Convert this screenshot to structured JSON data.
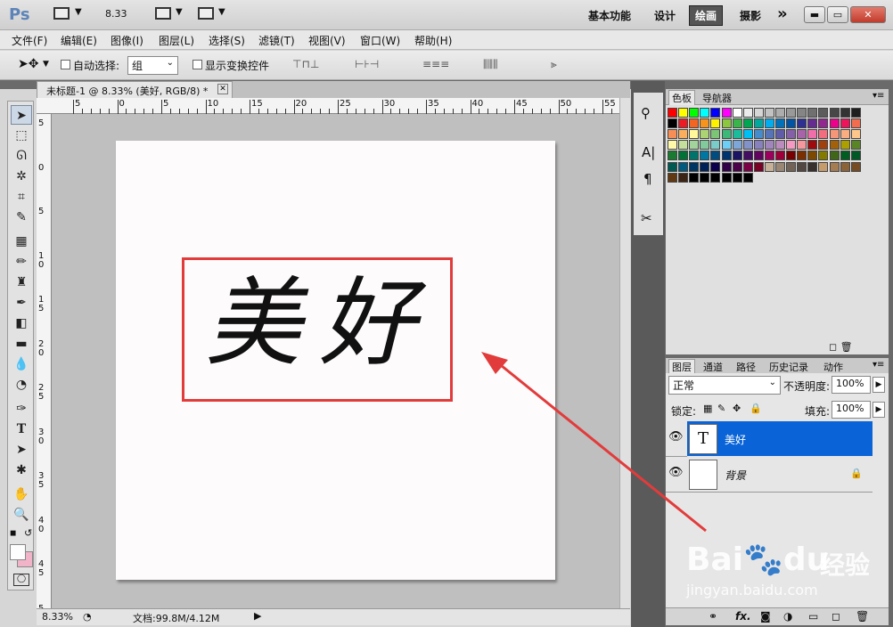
{
  "titlebar": {
    "logo": "Ps",
    "zoom": "8.33",
    "workspaces": [
      "基本功能",
      "设计",
      "绘画",
      "摄影"
    ],
    "active_workspace": "绘画",
    "more": "»"
  },
  "menu": [
    "文件(F)",
    "编辑(E)",
    "图像(I)",
    "图层(L)",
    "选择(S)",
    "滤镜(T)",
    "视图(V)",
    "窗口(W)",
    "帮助(H)"
  ],
  "options": {
    "auto_select_label": "自动选择:",
    "auto_select_value": "组",
    "show_transform_label": "显示变换控件"
  },
  "document": {
    "tab_title": "未标题-1 @ 8.33% (美好, RGB/8) *",
    "canvas_text": "美好",
    "ruler_h": [
      "5",
      "0",
      "5",
      "10",
      "15",
      "20",
      "25",
      "30",
      "35",
      "40",
      "45",
      "50",
      "55"
    ],
    "ruler_v": [
      "5",
      "0",
      "5",
      "1 0",
      "1 5",
      "2 0",
      "2 5",
      "3 0",
      "3 5",
      "4 0",
      "4 5",
      "5 0"
    ],
    "status_zoom": "8.33%",
    "status_doc": "文档:99.8M/4.12M"
  },
  "swatches_panel": {
    "tabs": [
      "色板",
      "导航器"
    ],
    "active_tab": "色板"
  },
  "swatch_colors": [
    [
      "#ff0000",
      "#ffff00",
      "#00ff00",
      "#00ffff",
      "#0000ff",
      "#ff00ff",
      "#ffffff",
      "#ebebeb",
      "#d6d6d6",
      "#c2c2c2",
      "#adadad",
      "#999999",
      "#858585",
      "#707070",
      "#5c5c5c",
      "#474747",
      "#333333",
      "#1f1f1f"
    ],
    [
      "#000000",
      "#ed1c24",
      "#f26522",
      "#f7941d",
      "#fff200",
      "#8dc63f",
      "#39b54a",
      "#00a651",
      "#00a99d",
      "#00aeef",
      "#0072bc",
      "#0054a6",
      "#2e3192",
      "#662d91",
      "#92278f",
      "#ec008c",
      "#ed145b",
      "#f26c4f"
    ],
    [
      "#f68e56",
      "#fbaf5d",
      "#fff799",
      "#acd373",
      "#7cc576",
      "#3cb878",
      "#1abc9c",
      "#00bff3",
      "#448ccb",
      "#5674b9",
      "#605ca8",
      "#855fa8",
      "#a864a8",
      "#f06eaa",
      "#f26d7d",
      "#f69679",
      "#f9ad81",
      "#fdc68a"
    ],
    [
      "#fff9a8",
      "#c4df9b",
      "#a3d39c",
      "#82ca9c",
      "#7accc8",
      "#6dcff6",
      "#7da7d9",
      "#8393ca",
      "#8781bd",
      "#a186be",
      "#bd8cbf",
      "#f49ac2",
      "#f5989d",
      "#9e0b0f",
      "#a0410d",
      "#a36209",
      "#aba000",
      "#598527"
    ],
    [
      "#197b30",
      "#007236",
      "#00746b",
      "#0076a3",
      "#004b80",
      "#003471",
      "#1b1464",
      "#440e62",
      "#630460",
      "#9e005d",
      "#9e0039",
      "#790000",
      "#7b2e00",
      "#7d4900",
      "#827b00",
      "#406618",
      "#005e20",
      "#005826"
    ],
    [
      "#005952",
      "#005b7f",
      "#003663",
      "#002157",
      "#0d004c",
      "#32004b",
      "#4b0049",
      "#7b0046",
      "#7a0026",
      "#c7b299",
      "#998675",
      "#736357",
      "#534741",
      "#37302d",
      "#c69c6d",
      "#a67c52",
      "#8c6239",
      "#754c24"
    ],
    [
      "#603913",
      "#3c2415",
      "#000000",
      "#000000",
      "#000000",
      "#000000",
      "#000000",
      "#000000"
    ]
  ],
  "layers_panel": {
    "tabs": [
      "图层",
      "通道",
      "路径",
      "历史记录",
      "动作"
    ],
    "active_tab": "图层",
    "blend_mode": "正常",
    "opacity_label": "不透明度:",
    "opacity_value": "100%",
    "lock_label": "锁定:",
    "fill_label": "填充:",
    "fill_value": "100%",
    "layers": [
      {
        "name": "美好",
        "thumb": "T",
        "selected": true
      },
      {
        "name": "背景",
        "thumb": "",
        "selected": false
      }
    ]
  },
  "watermark": {
    "brand": "Bai",
    "brand2": "du",
    "cn": "经验",
    "url": "jingyan.baidu.com"
  },
  "accent_colors": {
    "selection_blue": "#0a64d8",
    "annotation_red": "#e23b3b"
  }
}
